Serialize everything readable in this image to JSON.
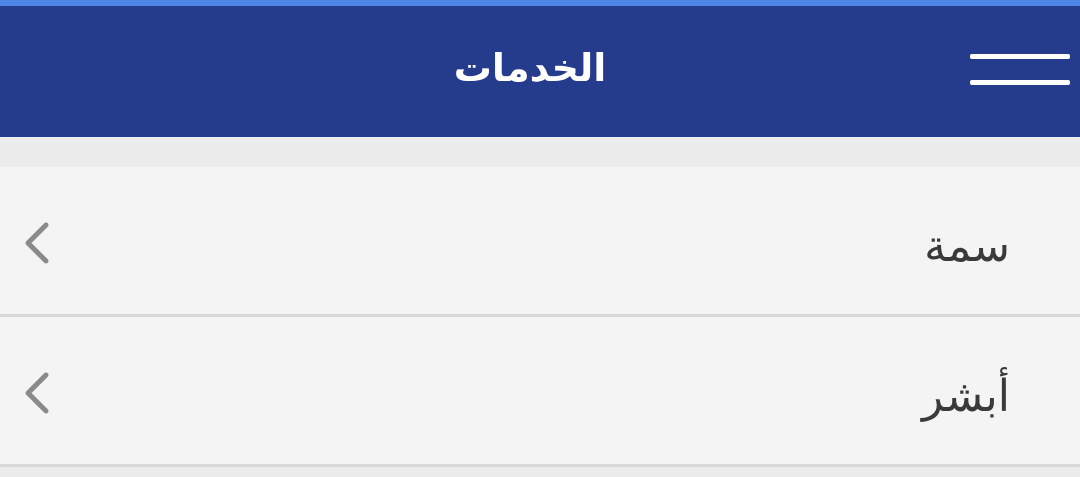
{
  "header": {
    "title": "الخدمات",
    "menu_icon": "hamburger-menu-icon",
    "background_color": "#253b8b",
    "accent_color": "#4d86e6"
  },
  "services": {
    "items": [
      {
        "label": "سمة",
        "icon": "chevron-left-icon"
      },
      {
        "label": "أبشر",
        "icon": "chevron-left-icon"
      }
    ]
  }
}
